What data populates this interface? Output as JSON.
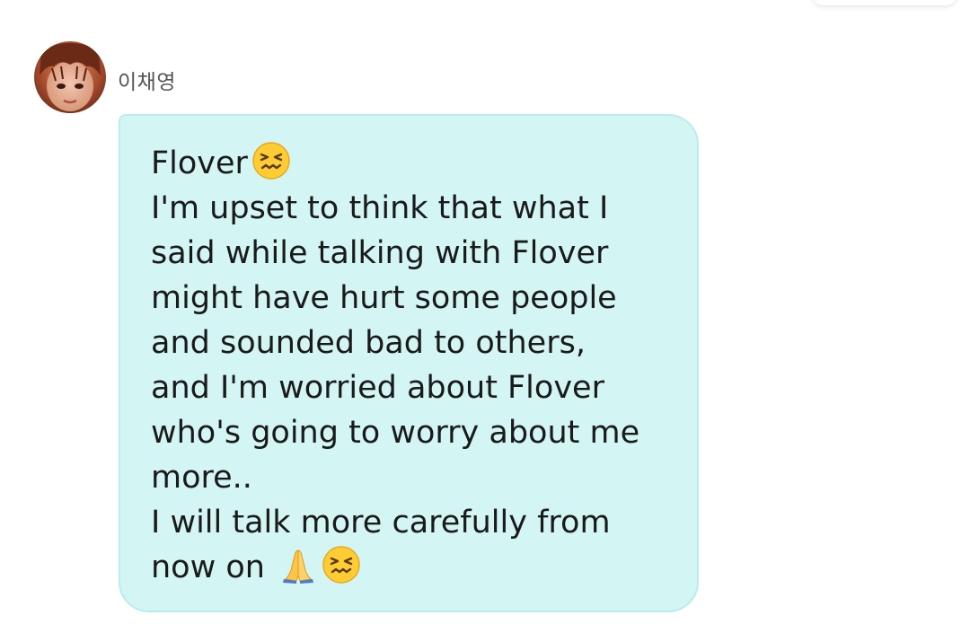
{
  "chat": {
    "sender": {
      "name": "이채영",
      "avatar_icon": "profile-photo-icon"
    },
    "message": {
      "lines": [
        "Flover",
        "I'm upset to think that what I",
        "said while talking with Flover",
        "might have hurt some people",
        "and sounded bad to others,",
        "and I'm worried about Flover",
        "who's going to worry about me",
        "more..",
        "I will talk more carefully from",
        "now on"
      ],
      "emojis": [
        "confounded-face-emoji",
        "folded-hands-emoji",
        "confounded-face-emoji"
      ]
    }
  },
  "colors": {
    "bubble_background": "#d3f6f5",
    "bubble_border": "#b9ecea",
    "text": "#1a1a1a",
    "sender_name": "#555555"
  }
}
